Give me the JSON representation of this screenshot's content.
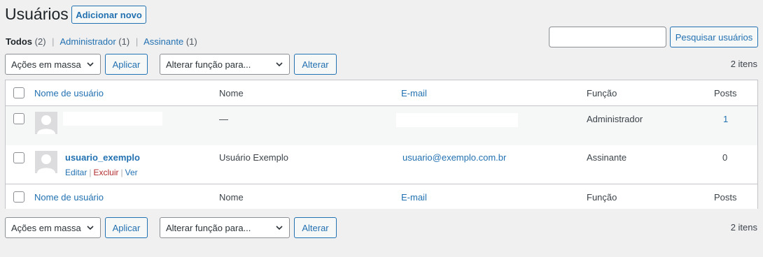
{
  "page": {
    "title": "Usuários",
    "add_new_label": "Adicionar novo"
  },
  "filters": {
    "all": {
      "label": "Todos",
      "count": "(2)"
    },
    "admin": {
      "label": "Administrador",
      "count": "(1)"
    },
    "subscriber": {
      "label": "Assinante",
      "count": "(1)"
    },
    "separator": "|"
  },
  "search": {
    "value": "",
    "button_label": "Pesquisar usuários"
  },
  "tablenav": {
    "bulk_select": "Ações em massa",
    "apply_label": "Aplicar",
    "role_select": "Alterar função para...",
    "change_label": "Alterar",
    "items_count": "2 itens"
  },
  "table": {
    "columns": {
      "username": "Nome de usuário",
      "name": "Nome",
      "email": "E-mail",
      "role": "Função",
      "posts": "Posts"
    },
    "rows": [
      {
        "username": "",
        "name": "—",
        "email": "",
        "role": "Administrador",
        "posts": "1"
      },
      {
        "username": "usuario_exemplo",
        "name": "Usuário Exemplo",
        "email": "usuario@exemplo.com.br",
        "role": "Assinante",
        "posts": "0"
      }
    ],
    "row_actions": {
      "edit": "Editar",
      "delete": "Excluir",
      "view": "Ver",
      "separator": "|"
    }
  },
  "colors": {
    "link": "#2271b1",
    "delete": "#b32d2e",
    "background": "#f0f0f1"
  },
  "icons": [
    "chevron-down-icon",
    "avatar-placeholder-icon",
    "checkbox"
  ]
}
